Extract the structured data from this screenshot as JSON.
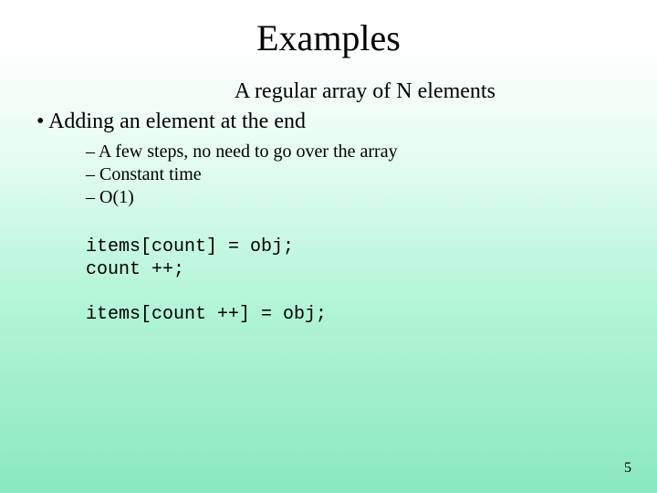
{
  "slide": {
    "title": "Examples",
    "subtitle": "A regular array of N elements",
    "bullet1": "Adding an element at the end",
    "sub1": "A few steps, no need to go over the array",
    "sub2": "Constant time",
    "sub3": "O(1)",
    "code1": "items[count] = obj;\ncount ++;",
    "code2": "items[count ++] = obj;",
    "page": "5"
  }
}
